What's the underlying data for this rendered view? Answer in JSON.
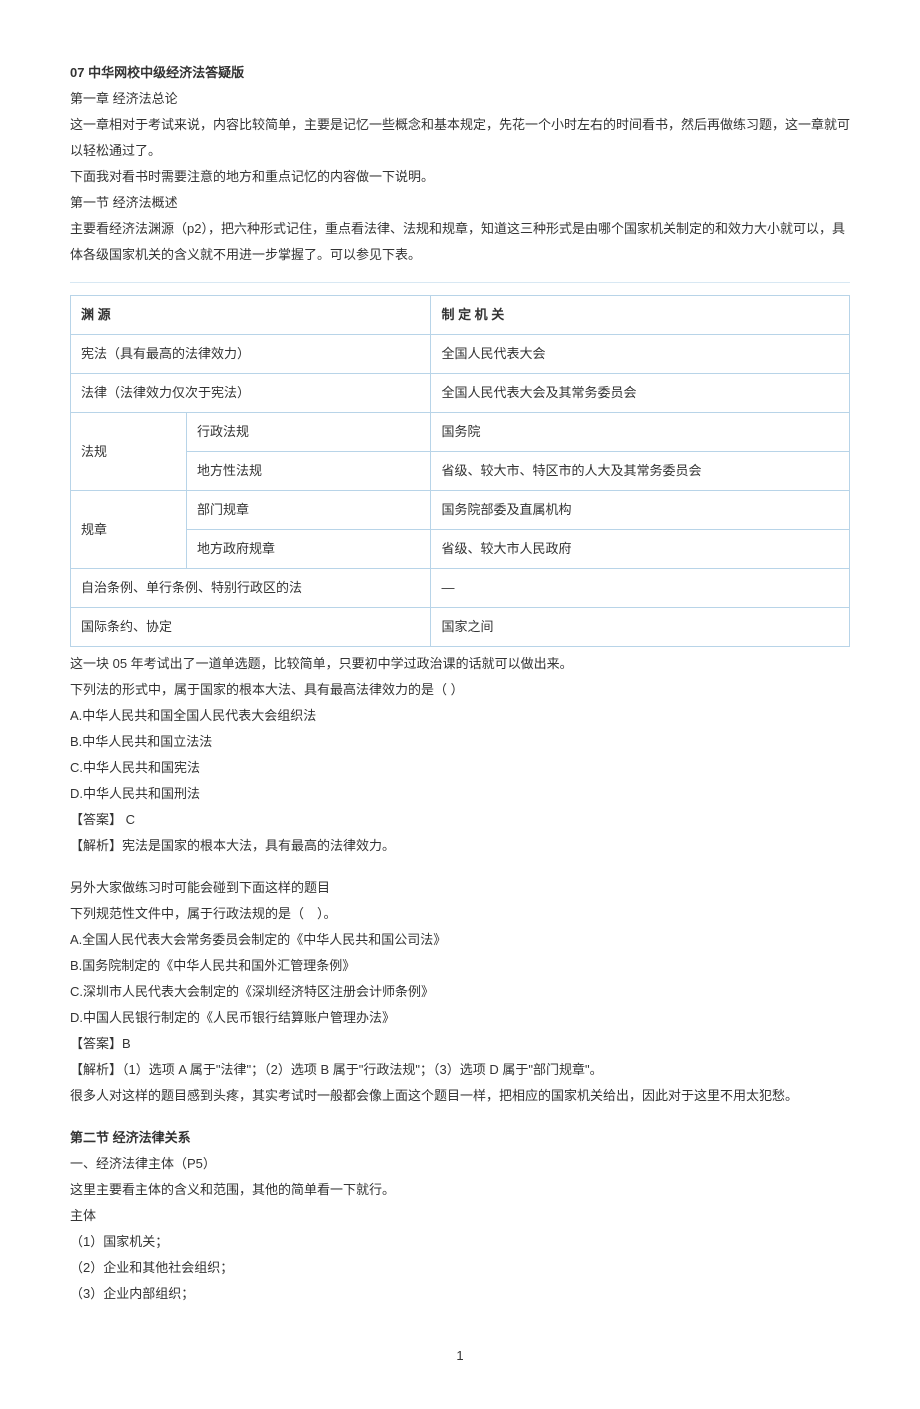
{
  "title": "07 中华网校中级经济法答疑版",
  "intro": {
    "chapter": "第一章 经济法总论",
    "p1": "这一章相对于考试来说，内容比较简单，主要是记忆一些概念和基本规定，先花一个小时左右的时间看书，然后再做练习题，这一章就可以轻松通过了。",
    "p2": "下面我对看书时需要注意的地方和重点记忆的内容做一下说明。",
    "section1": "第一节 经济法概述",
    "p3": "主要看经济法渊源（p2），把六种形式记住，重点看法律、法规和规章，知道这三种形式是由哪个国家机关制定的和效力大小就可以，具体各级国家机关的含义就不用进一步掌握了。可以参见下表。"
  },
  "table": {
    "h1": "渊 源",
    "h2": "制 定 机 关",
    "r1c1": "宪法（具有最高的法律效力）",
    "r1c2": "全国人民代表大会",
    "r2c1": "法律（法律效力仅次于宪法）",
    "r2c2": "全国人民代表大会及其常务委员会",
    "r3c1": "法规",
    "r3c2": "行政法规",
    "r3c3": "国务院",
    "r4c2": "地方性法规",
    "r4c3": "省级、较大市、特区市的人大及其常务委员会",
    "r5c1": "规章",
    "r5c2": "部门规章",
    "r5c3": "国务院部委及直属机构",
    "r6c2": "地方政府规章",
    "r6c3": "省级、较大市人民政府",
    "r7c1": "自治条例、单行条例、特别行政区的法",
    "r7c2": "—",
    "r8c1": "国际条约、协定",
    "r8c2": "国家之间"
  },
  "q1": {
    "p0": "这一块 05 年考试出了一道单选题，比较简单，只要初中学过政治课的话就可以做出来。",
    "stem": "下列法的形式中，属于国家的根本大法、具有最高法律效力的是（ ）",
    "a": "A.中华人民共和国全国人民代表大会组织法",
    "b": "B.中华人民共和国立法法",
    "c": "C.中华人民共和国宪法",
    "d": "D.中华人民共和国刑法",
    "ans": "【答案】 C",
    "exp": "【解析】宪法是国家的根本大法，具有最高的法律效力。"
  },
  "q2": {
    "p0": "另外大家做练习时可能会碰到下面这样的题目",
    "stem": "下列规范性文件中，属于行政法规的是（　）。",
    "a": "A.全国人民代表大会常务委员会制定的《中华人民共和国公司法》",
    "b": "B.国务院制定的《中华人民共和国外汇管理条例》",
    "c": "C.深圳市人民代表大会制定的《深圳经济特区注册会计师条例》",
    "d": "D.中国人民银行制定的《人民币银行结算账户管理办法》",
    "ans": "【答案】B",
    "exp": "【解析】（1）选项 A 属于\"法律\"；（2）选项 B 属于\"行政法规\"；（3）选项 D 属于\"部门规章\"。",
    "note": "很多人对这样的题目感到头疼，其实考试时一般都会像上面这个题目一样，把相应的国家机关给出，因此对于这里不用太犯愁。"
  },
  "section2": {
    "title": "第二节 经济法律关系",
    "p1": "一、经济法律主体（P5）",
    "p2": "这里主要看主体的含义和范围，其他的简单看一下就行。",
    "p3": "主体",
    "i1": "（1）国家机关；",
    "i2": "（2）企业和其他社会组织；",
    "i3": "（3）企业内部组织；"
  },
  "pagenum": "1"
}
